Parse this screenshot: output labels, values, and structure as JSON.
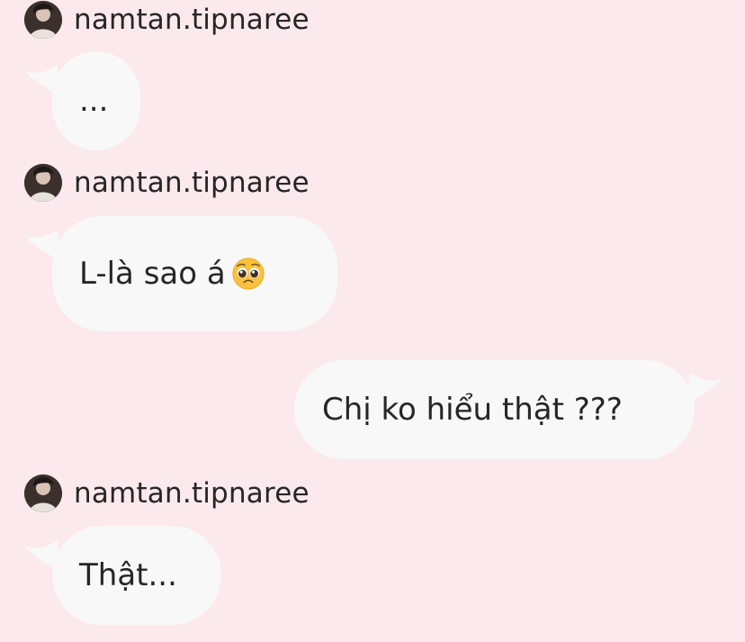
{
  "thread": {
    "messages": [
      {
        "sender": "namtan.tipnaree",
        "direction": "incoming",
        "text": "..."
      },
      {
        "sender": "namtan.tipnaree",
        "direction": "incoming",
        "text": "L-là sao á",
        "emoji": "pleading-face-emoji"
      },
      {
        "sender": "",
        "direction": "outgoing",
        "text": "Chị ko hiểu thật ???"
      },
      {
        "sender": "namtan.tipnaree",
        "direction": "incoming",
        "text": "Thật..."
      }
    ]
  },
  "colors": {
    "background": "#fbe9ee",
    "bubble": "#f8f8f8",
    "text": "#262626"
  }
}
